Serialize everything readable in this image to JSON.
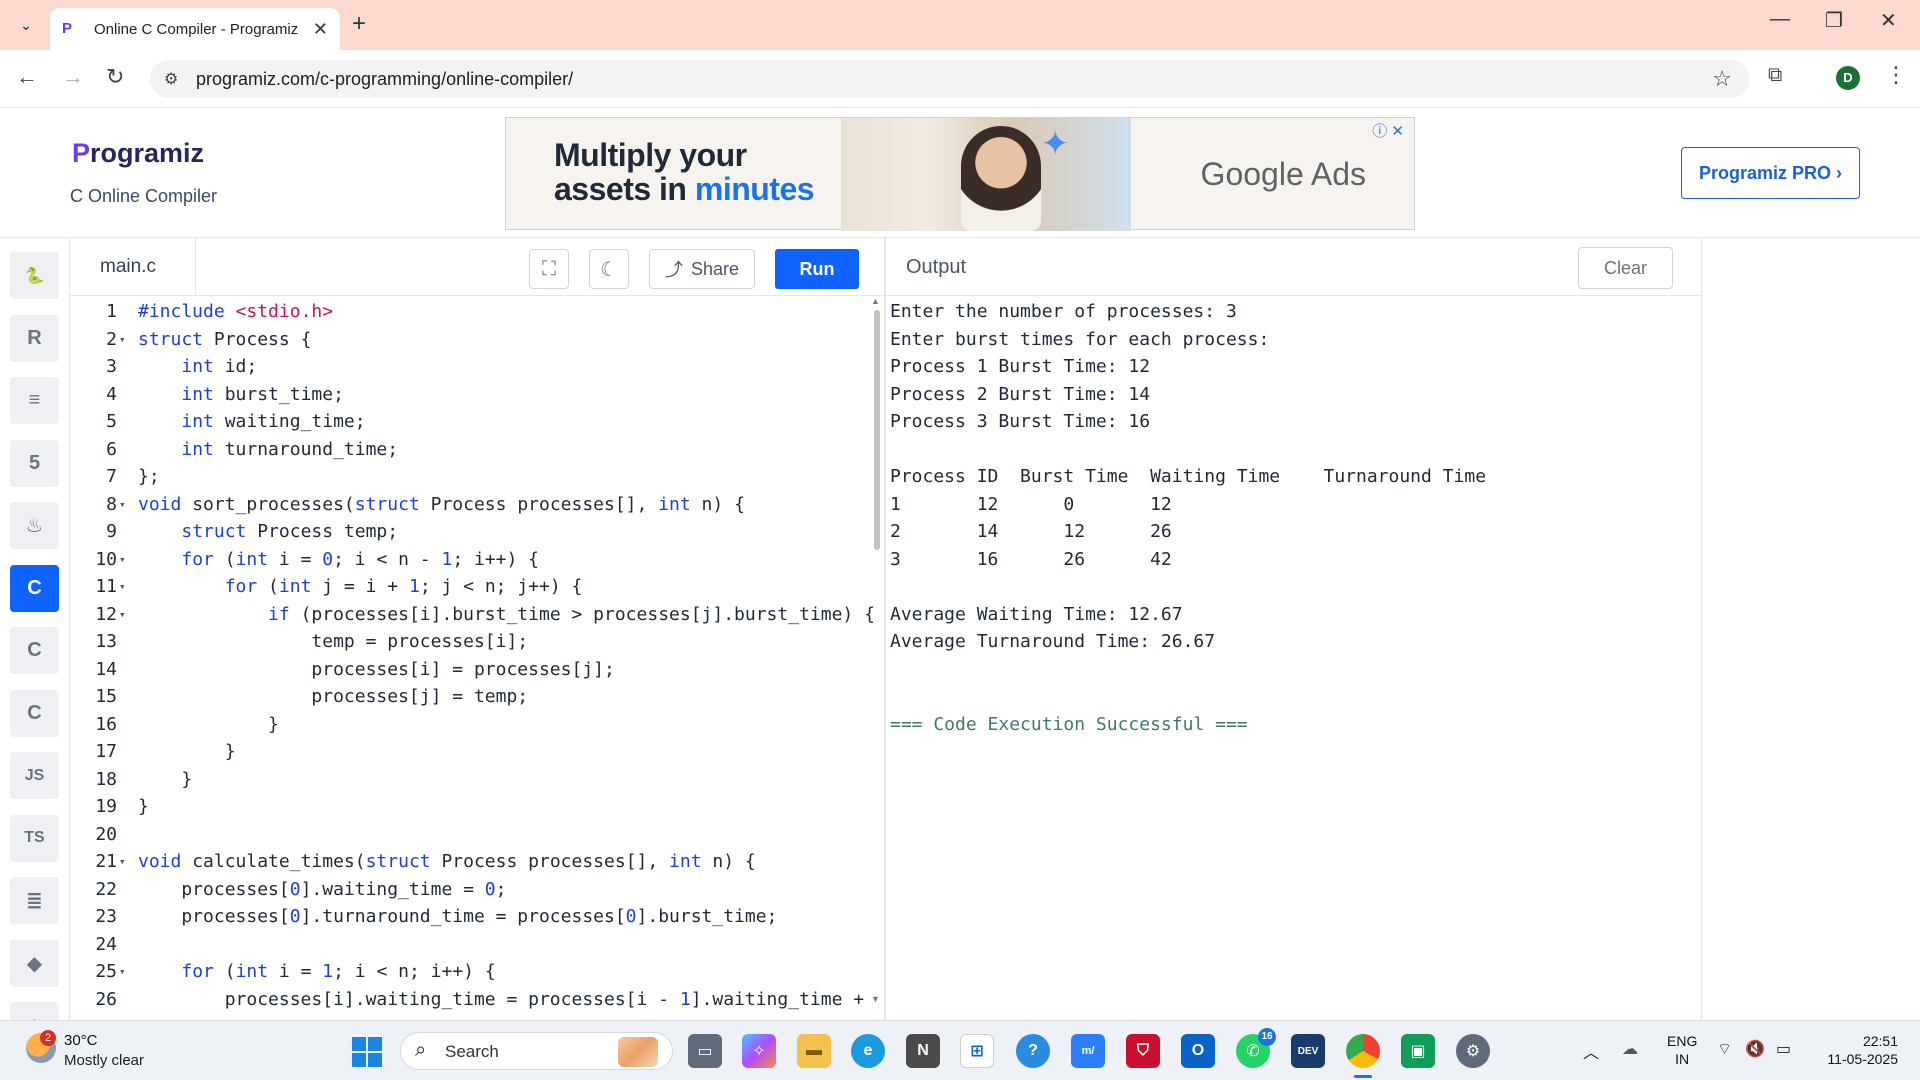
{
  "browser": {
    "tab_title": "Online C Compiler - Programiz",
    "tab_favicon": "P",
    "url": "programiz.com/c-programming/online-compiler/",
    "profile_initial": "D"
  },
  "site": {
    "logo_first": "P",
    "logo_rest": "rogramiz",
    "subtitle": "C Online Compiler",
    "pro_button": "Programiz PRO ›",
    "ad": {
      "line1": "Multiply your",
      "line2_a": "assets in ",
      "line2_b": "minutes",
      "brand": "Google Ads"
    }
  },
  "sidebar": {
    "items": [
      {
        "icon": "python-icon",
        "glyph": "🐍"
      },
      {
        "icon": "r-icon",
        "glyph": "R"
      },
      {
        "icon": "sql-icon",
        "glyph": "≡"
      },
      {
        "icon": "html-icon",
        "glyph": "5"
      },
      {
        "icon": "java-icon",
        "glyph": "♨"
      },
      {
        "icon": "c-icon",
        "glyph": "C",
        "active": true
      },
      {
        "icon": "cpp-icon",
        "glyph": "C"
      },
      {
        "icon": "csharp-icon",
        "glyph": "C"
      },
      {
        "icon": "js-icon",
        "glyph": "JS"
      },
      {
        "icon": "ts-icon",
        "glyph": "TS"
      },
      {
        "icon": "go-icon",
        "glyph": "≣"
      },
      {
        "icon": "swift-icon",
        "glyph": "◆"
      },
      {
        "icon": "rust-icon",
        "glyph": "⬗"
      }
    ]
  },
  "editor": {
    "filename": "main.c",
    "share_label": "Share",
    "run_label": "Run",
    "lines": [
      {
        "n": "1",
        "fold": "",
        "html": "<span class='k'>#include</span> <span class='s'>&lt;stdio.h&gt;</span>"
      },
      {
        "n": "2",
        "fold": "▾",
        "html": "<span class='k'>struct</span> Process {"
      },
      {
        "n": "3",
        "fold": "",
        "html": "    <span class='k'>int</span> id;"
      },
      {
        "n": "4",
        "fold": "",
        "html": "    <span class='k'>int</span> burst_time;"
      },
      {
        "n": "5",
        "fold": "",
        "html": "    <span class='k'>int</span> waiting_time;"
      },
      {
        "n": "6",
        "fold": "",
        "html": "    <span class='k'>int</span> turnaround_time;"
      },
      {
        "n": "7",
        "fold": "",
        "html": "};"
      },
      {
        "n": "8",
        "fold": "▾",
        "html": "<span class='k'>void</span> sort_processes(<span class='k'>struct</span> Process processes[], <span class='k'>int</span> n) {"
      },
      {
        "n": "9",
        "fold": "",
        "html": "    <span class='k'>struct</span> Process temp;"
      },
      {
        "n": "10",
        "fold": "▾",
        "html": "    <span class='k'>for</span> (<span class='k'>int</span> i = <span class='n'>0</span>; i &lt; n - <span class='n'>1</span>; i++) {"
      },
      {
        "n": "11",
        "fold": "▾",
        "html": "        <span class='k'>for</span> (<span class='k'>int</span> j = i + <span class='n'>1</span>; j &lt; n; j++) {"
      },
      {
        "n": "12",
        "fold": "▾",
        "html": "            <span class='k'>if</span> (processes[i].burst_time &gt; processes[j].burst_time) {"
      },
      {
        "n": "13",
        "fold": "",
        "html": "                temp = processes[i];"
      },
      {
        "n": "14",
        "fold": "",
        "html": "                processes[i] = processes[j];"
      },
      {
        "n": "15",
        "fold": "",
        "html": "                processes[j] = temp;"
      },
      {
        "n": "16",
        "fold": "",
        "html": "            }"
      },
      {
        "n": "17",
        "fold": "",
        "html": "        }"
      },
      {
        "n": "18",
        "fold": "",
        "html": "    }"
      },
      {
        "n": "19",
        "fold": "",
        "html": "}"
      },
      {
        "n": "20",
        "fold": "",
        "html": ""
      },
      {
        "n": "21",
        "fold": "▾",
        "html": "<span class='k'>void</span> calculate_times(<span class='k'>struct</span> Process processes[], <span class='k'>int</span> n) {"
      },
      {
        "n": "22",
        "fold": "",
        "html": "    processes[<span class='n'>0</span>].waiting_time = <span class='n'>0</span>;"
      },
      {
        "n": "23",
        "fold": "",
        "html": "    processes[<span class='n'>0</span>].turnaround_time = processes[<span class='n'>0</span>].burst_time;"
      },
      {
        "n": "24",
        "fold": "",
        "html": ""
      },
      {
        "n": "25",
        "fold": "▾",
        "html": "    <span class='k'>for</span> (<span class='k'>int</span> i = <span class='n'>1</span>; i &lt; n; i++) {"
      },
      {
        "n": "26",
        "fold": "",
        "html": "        processes[i].waiting_time = processes[i - <span class='n'>1</span>].waiting_time +"
      }
    ]
  },
  "output": {
    "title": "Output",
    "clear_label": "Clear",
    "lines": [
      {
        "text": "Enter the number of processes: 3",
        "kind": "normal"
      },
      {
        "text": "Enter burst times for each process:",
        "kind": "normal"
      },
      {
        "text": "Process 1 Burst Time: 12",
        "kind": "normal"
      },
      {
        "text": "Process 2 Burst Time: 14",
        "kind": "normal"
      },
      {
        "text": "Process 3 Burst Time: 16",
        "kind": "normal"
      },
      {
        "text": "",
        "kind": "normal"
      },
      {
        "text": "Process ID  Burst Time  Waiting Time    Turnaround Time",
        "kind": "normal"
      },
      {
        "text": "1       12      0       12",
        "kind": "normal"
      },
      {
        "text": "2       14      12      26",
        "kind": "normal"
      },
      {
        "text": "3       16      26      42",
        "kind": "normal"
      },
      {
        "text": "",
        "kind": "normal"
      },
      {
        "text": "Average Waiting Time: 12.67",
        "kind": "normal"
      },
      {
        "text": "Average Turnaround Time: 26.67",
        "kind": "normal"
      },
      {
        "text": "",
        "kind": "normal"
      },
      {
        "text": "",
        "kind": "normal"
      },
      {
        "text": "=== Code Execution Successful ===",
        "kind": "success"
      }
    ]
  },
  "taskbar": {
    "weather_badge": "2",
    "temperature": "30°C",
    "weather_desc": "Mostly clear",
    "search_label": "Search",
    "whatsapp_badge": "16",
    "lang_line1": "ENG",
    "lang_line2": "IN",
    "time": "22:51",
    "date": "11-05-2025"
  }
}
